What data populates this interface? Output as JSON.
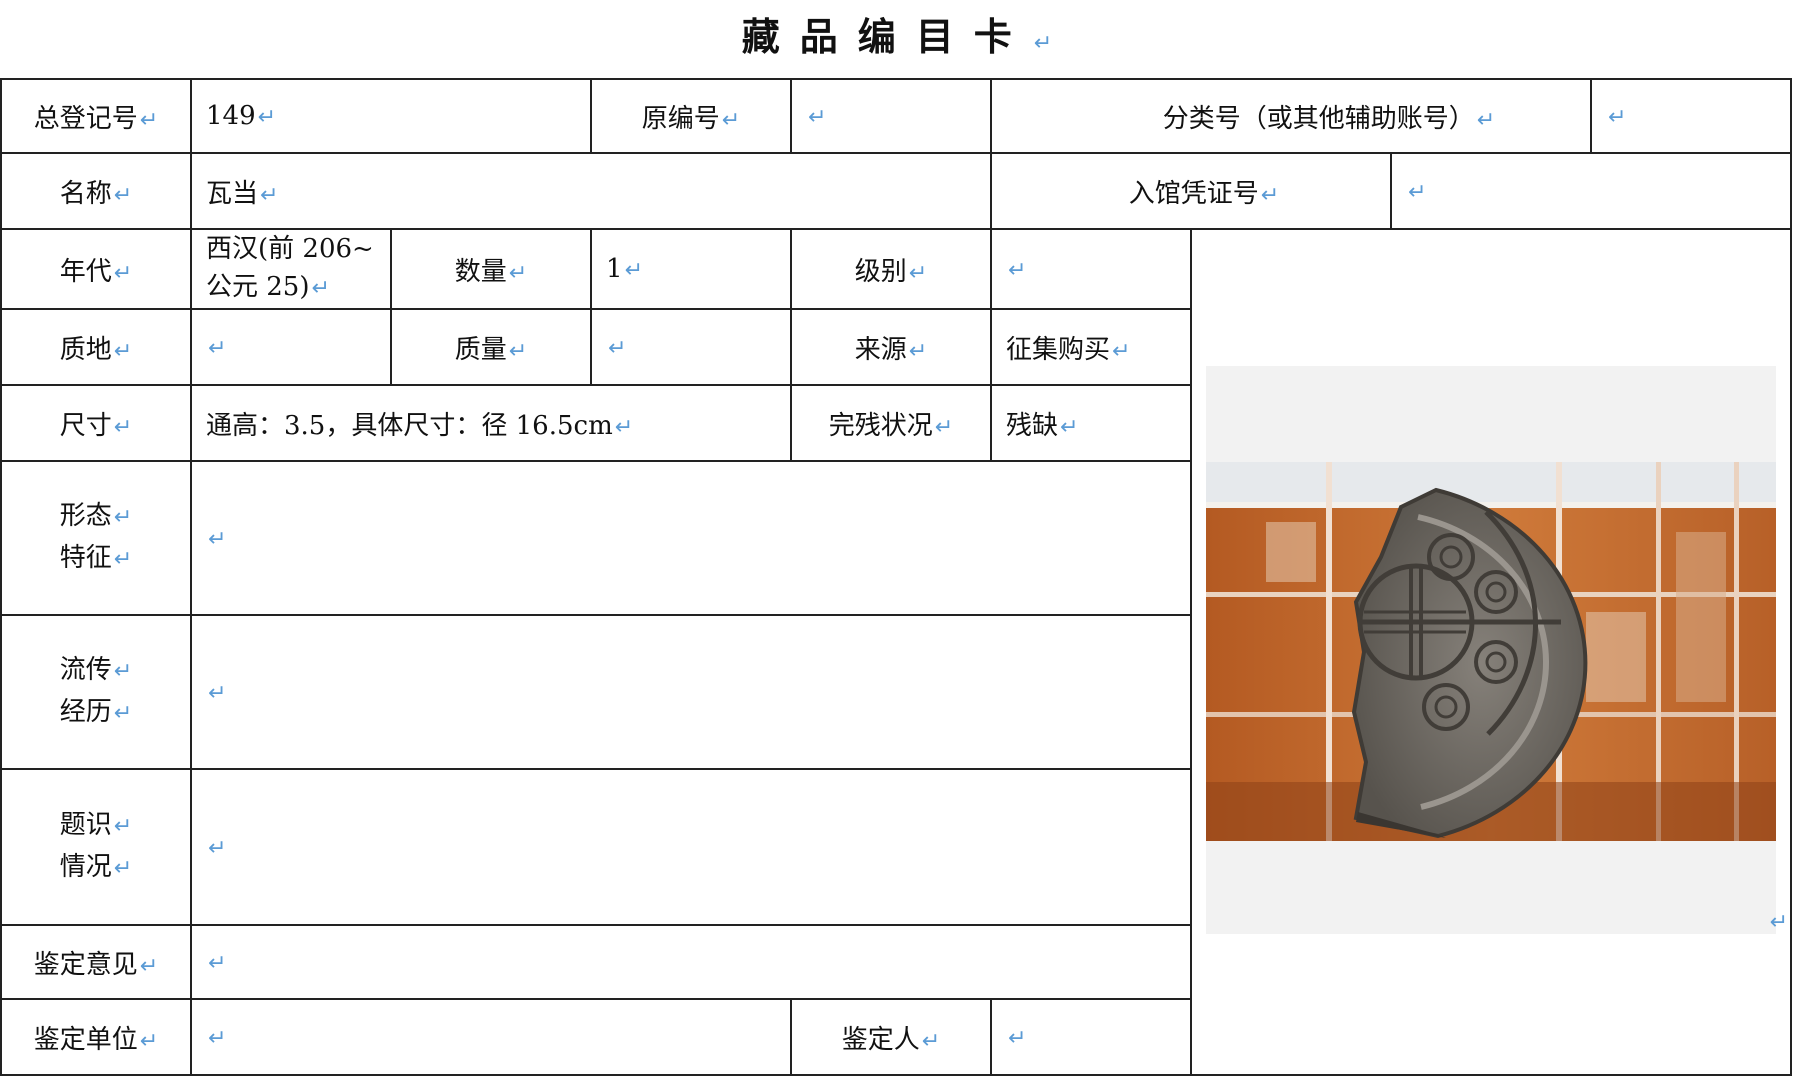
{
  "title": "藏品编目卡",
  "ret": "↵",
  "row1": {
    "zongdengji_label": "总登记号",
    "zongdengji_value": "149",
    "yuanbian_label": "原编号",
    "yuanbian_value": "",
    "fenlei_label": "分类号（或其他辅助账号）",
    "fenlei_value": ""
  },
  "row2": {
    "name_label": "名称",
    "name_value": "瓦当",
    "pingzheng_label": "入馆凭证号",
    "pingzheng_value": ""
  },
  "row3": {
    "niandai_label": "年代",
    "niandai_line1": "西汉(前 206~",
    "niandai_line2": "公元 25)",
    "shuliang_label": "数量",
    "shuliang_value": "1",
    "jibie_label": "级别",
    "jibie_value": ""
  },
  "row4": {
    "zhidi_label": "质地",
    "zhidi_value": "",
    "zhiliang_label": "质量",
    "zhiliang_value": "",
    "laiyuan_label": "来源",
    "laiyuan_value": "征集购买"
  },
  "row5": {
    "chicun_label": "尺寸",
    "chicun_value": "通高：3.5，具体尺寸：径 16.5cm",
    "wancan_label": "完残状况",
    "wancan_value": "残缺"
  },
  "xingtai": {
    "label_line1": "形态",
    "label_line2": "特征",
    "value": ""
  },
  "liuchuan": {
    "label_line1": "流传",
    "label_line2": "经历",
    "value": ""
  },
  "tizhi": {
    "label_line1": "题识",
    "label_line2": "情况",
    "value": ""
  },
  "jianding_yijian": {
    "label": "鉴定意见",
    "value": ""
  },
  "jianding_danwei": {
    "label": "鉴定单位",
    "value": "",
    "person_label": "鉴定人",
    "person_value": ""
  },
  "colors": {
    "paragraph_mark": "#5b9bd5",
    "border": "#222222",
    "photo_background": "#f2f2f2",
    "tile_orange": "#c4692b",
    "tile_gray": "#6e6a64"
  },
  "photo": {
    "subject": "eave-tile-photo"
  }
}
